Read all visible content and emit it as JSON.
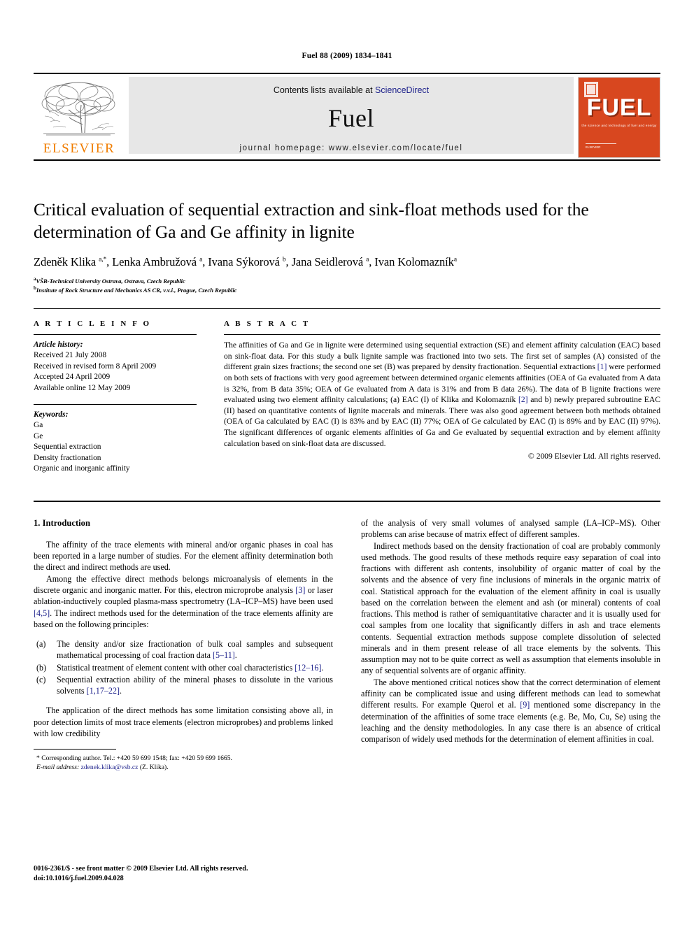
{
  "running_head": "Fuel 88 (2009) 1834–1841",
  "masthead": {
    "publisher_name": "ELSEVIER",
    "contents_prefix": "Contents lists available at",
    "contents_link": "ScienceDirect",
    "journal_name": "Fuel",
    "homepage": "journal homepage: www.elsevier.com/locate/fuel",
    "cover": {
      "title": "FUEL",
      "subtitle": "the science and technology of fuel and energy",
      "footer": "ELSEVIER"
    },
    "link_color": "#1b1f8a",
    "brand_orange": "#f07d00",
    "cover_color": "#d8471f"
  },
  "article": {
    "title": "Critical evaluation of sequential extraction and sink-float methods used for the determination of Ga and Ge affinity in lignite",
    "authors_html": "Zdeněk Klika <sup>a,*</sup>, Lenka Ambružová <sup>a</sup>, Ivana Sýkorová <sup>b</sup>, Jana Seidlerová <sup>a</sup>, Ivan Kolomazník<sup>a</sup>",
    "affiliations": [
      {
        "mark": "a",
        "text": "VŠB-Technical University Ostrava, Ostrava, Czech Republic"
      },
      {
        "mark": "b",
        "text": "Institute of Rock Structure and Mechanics AS CR, v.v.i., Prague, Czech Republic"
      }
    ]
  },
  "article_info": {
    "heading": "A R T I C L E   I N F O",
    "history_label": "Article history:",
    "history": [
      "Received 21 July 2008",
      "Received in revised form 8 April 2009",
      "Accepted 24 April 2009",
      "Available online 12 May 2009"
    ],
    "keywords_label": "Keywords:",
    "keywords": [
      "Ga",
      "Ge",
      "Sequential extraction",
      "Density fractionation",
      "Organic and inorganic affinity"
    ]
  },
  "abstract": {
    "heading": "A B S T R A C T",
    "body_html": "The affinities of Ga and Ge in lignite were determined using sequential extraction (SE) and element affinity calculation (EAC) based on sink-float data. For this study a bulk lignite sample was fractioned into two sets. The first set of samples (A) consisted of the different grain sizes fractions; the second one set (B) was prepared by density fractionation. Sequential extractions <span class=\"link\">[1]</span> were performed on both sets of fractions with very good agreement between determined organic elements affinities (OEA of Ga evaluated from A data is 32%, from B data 35%; OEA of Ge evaluated from A data is 31% and from B data 26%). The data of B lignite fractions were evaluated using two element affinity calculations; (a) EAC (I) of Klika and Kolomazník <span class=\"link\">[2]</span> and b) newly prepared subroutine EAC (II) based on quantitative contents of lignite macerals and minerals. There was also good agreement between both methods obtained (OEA of Ga calculated by EAC (I) is 83% and by EAC (II) 77%; OEA of Ge calculated by EAC (I) is 89% and by EAC (II) 97%). The significant differences of organic elements affinities of Ga and Ge evaluated by sequential extraction and by element affinity calculation based on sink-float data are discussed.",
    "copyright": "© 2009 Elsevier Ltd. All rights reserved."
  },
  "introduction": {
    "heading": "1. Introduction",
    "left_paragraphs_html": [
      "The affinity of the trace elements with mineral and/or organic phases in coal has been reported in a large number of studies. For the element affinity determination both the direct and indirect methods are used.",
      "Among the effective direct methods belongs microanalysis of elements in the discrete organic and inorganic matter. For this, electron microprobe analysis <span class=\"link\">[3]</span> or laser ablation-inductively coupled plasma-mass spectrometry (LA–ICP–MS) have been used <span class=\"link\">[4,5]</span>. The indirect methods used for the determination of the trace elements affinity are based on the following principles:"
    ],
    "list": [
      {
        "marker": "(a)",
        "text_html": "The density and/or size fractionation of bulk coal samples and subsequent mathematical processing of coal fraction data <span class=\"link\">[5–11]</span>."
      },
      {
        "marker": "(b)",
        "text_html": "Statistical treatment of element content with other coal characteristics <span class=\"link\">[12–16]</span>."
      },
      {
        "marker": "(c)",
        "text_html": "Sequential extraction ability of the mineral phases to dissolute in the various solvents <span class=\"link\">[1,17–22]</span>."
      }
    ],
    "left_tail_html": "The application of the direct methods has some limitation consisting above all, in poor detection limits of most trace elements (electron microprobes) and problems linked with low credibility",
    "right_paragraphs_html": [
      "of the analysis of very small volumes of analysed sample (LA–ICP–MS). Other problems can arise because of matrix effect of different samples.",
      "Indirect methods based on the density fractionation of coal are probably commonly used methods. The good results of these methods require easy separation of coal into fractions with different ash contents, insolubility of organic matter of coal by the solvents and the absence of very fine inclusions of minerals in the organic matrix of coal. Statistical approach for the evaluation of the element affinity in coal is usually based on the correlation between the element and ash (or mineral) contents of coal fractions. This method is rather of semiquantitative character and it is usually used for coal samples from one locality that significantly differs in ash and trace elements contents. Sequential extraction methods suppose complete dissolution of selected minerals and in them present release of all trace elements by the solvents. This assumption may not to be quite correct as well as assumption that elements insoluble in any of sequential solvents are of organic affinity.",
      "The above mentioned critical notices show that the correct determination of element affinity can be complicated issue and using different methods can lead to somewhat different results. For example Querol et al. <span class=\"link\">[9]</span> mentioned some discrepancy in the determination of the affinities of some trace elements (e.g. Be, Mo, Cu, Se) using the leaching and the density methodologies. In any case there is an absence of critical comparison of widely used methods for the determination of element affinities in coal."
    ]
  },
  "footnote": {
    "marker": "*",
    "corresponding_html": "Corresponding author. Tel.: +420 59 699 1548; fax: +420 59 699 1665.",
    "email_label": "E-mail address:",
    "email": "zdenek.klika@vsb.cz",
    "email_suffix": "(Z. Klika)."
  },
  "page_footer": {
    "issn_line": "0016-2361/$ - see front matter © 2009 Elsevier Ltd. All rights reserved.",
    "doi_line": "doi:10.1016/j.fuel.2009.04.028"
  }
}
